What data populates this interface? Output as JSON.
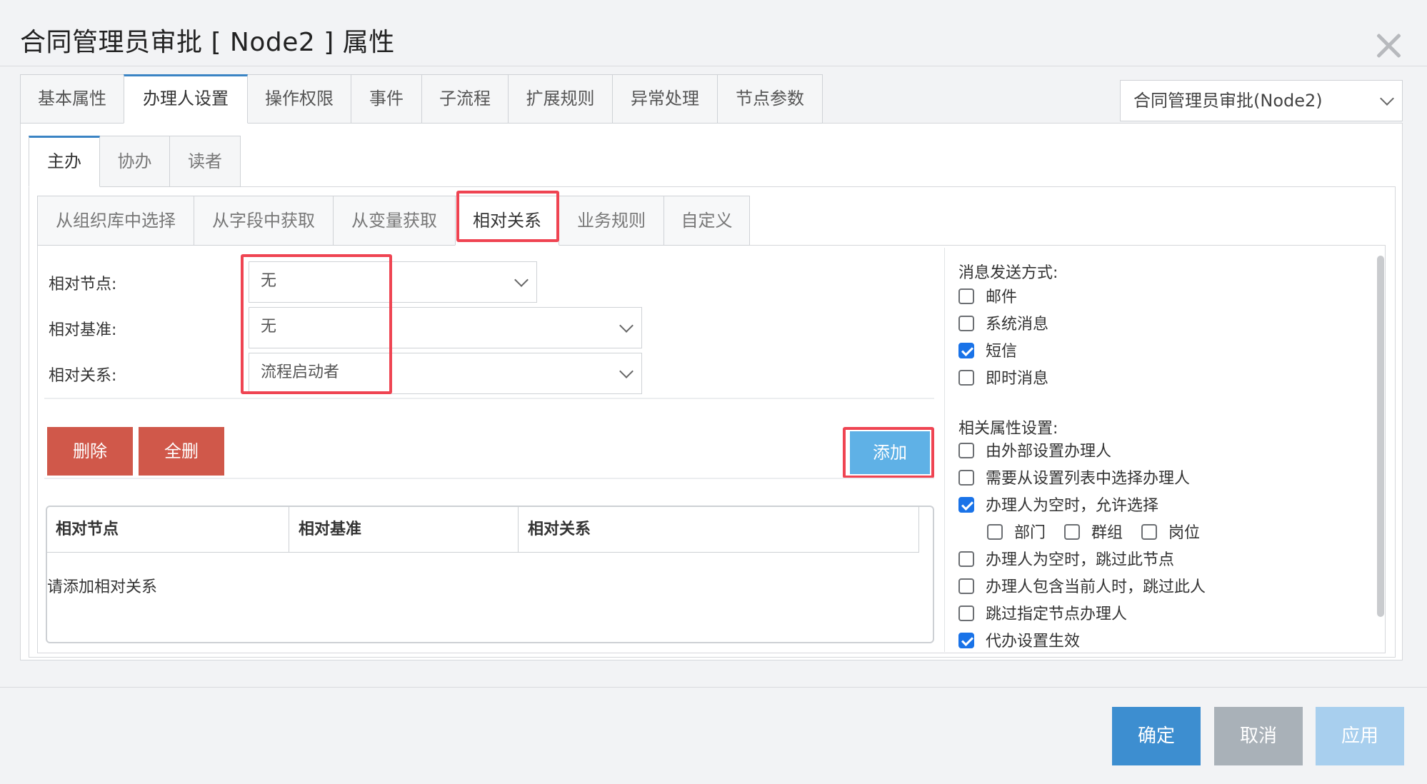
{
  "dialog": {
    "title": "合同管理员审批 [ Node2 ] 属性"
  },
  "tabs": [
    "基本属性",
    "办理人设置",
    "操作权限",
    "事件",
    "子流程",
    "扩展规则",
    "异常处理",
    "节点参数"
  ],
  "node_select": {
    "value": "合同管理员审批(Node2)"
  },
  "sub_tabs": [
    "主办",
    "协办",
    "读者"
  ],
  "third_tabs": [
    "从组织库中选择",
    "从字段中获取",
    "从变量获取",
    "相对关系",
    "业务规则",
    "自定义"
  ],
  "form": {
    "relative_node": {
      "label": "相对节点:",
      "value": "无"
    },
    "relative_base": {
      "label": "相对基准:",
      "value": "无"
    },
    "relative_relation": {
      "label": "相对关系:",
      "value": "流程启动者"
    }
  },
  "buttons": {
    "delete": "删除",
    "delete_all": "全删",
    "add": "添加"
  },
  "table": {
    "columns": [
      "相对节点",
      "相对基准",
      "相对关系"
    ],
    "empty_text": "请添加相对关系"
  },
  "message": {
    "title": "消息发送方式:",
    "options": [
      {
        "label": "邮件",
        "checked": false
      },
      {
        "label": "系统消息",
        "checked": false
      },
      {
        "label": "短信",
        "checked": true
      },
      {
        "label": "即时消息",
        "checked": false
      }
    ]
  },
  "related": {
    "title": "相关属性设置:",
    "options": [
      {
        "label": "由外部设置办理人",
        "checked": false
      },
      {
        "label": "需要从设置列表中选择办理人",
        "checked": false
      },
      {
        "label": "办理人为空时，允许选择",
        "checked": true
      },
      {
        "label": "办理人为空时，跳过此节点",
        "checked": false
      },
      {
        "label": "办理人包含当前人时，跳过此人",
        "checked": false
      },
      {
        "label": "跳过指定节点办理人",
        "checked": false
      },
      {
        "label": "代办设置生效",
        "checked": true
      }
    ],
    "sub_options": [
      {
        "label": "部门",
        "checked": false
      },
      {
        "label": "群组",
        "checked": false
      },
      {
        "label": "岗位",
        "checked": false
      }
    ]
  },
  "footer": {
    "ok": "确定",
    "cancel": "取消",
    "apply": "应用"
  },
  "colors": {
    "accent": "#3a84c4",
    "danger": "#d0584a",
    "add_button": "#5fb1e6",
    "highlight": "#ef4452"
  }
}
